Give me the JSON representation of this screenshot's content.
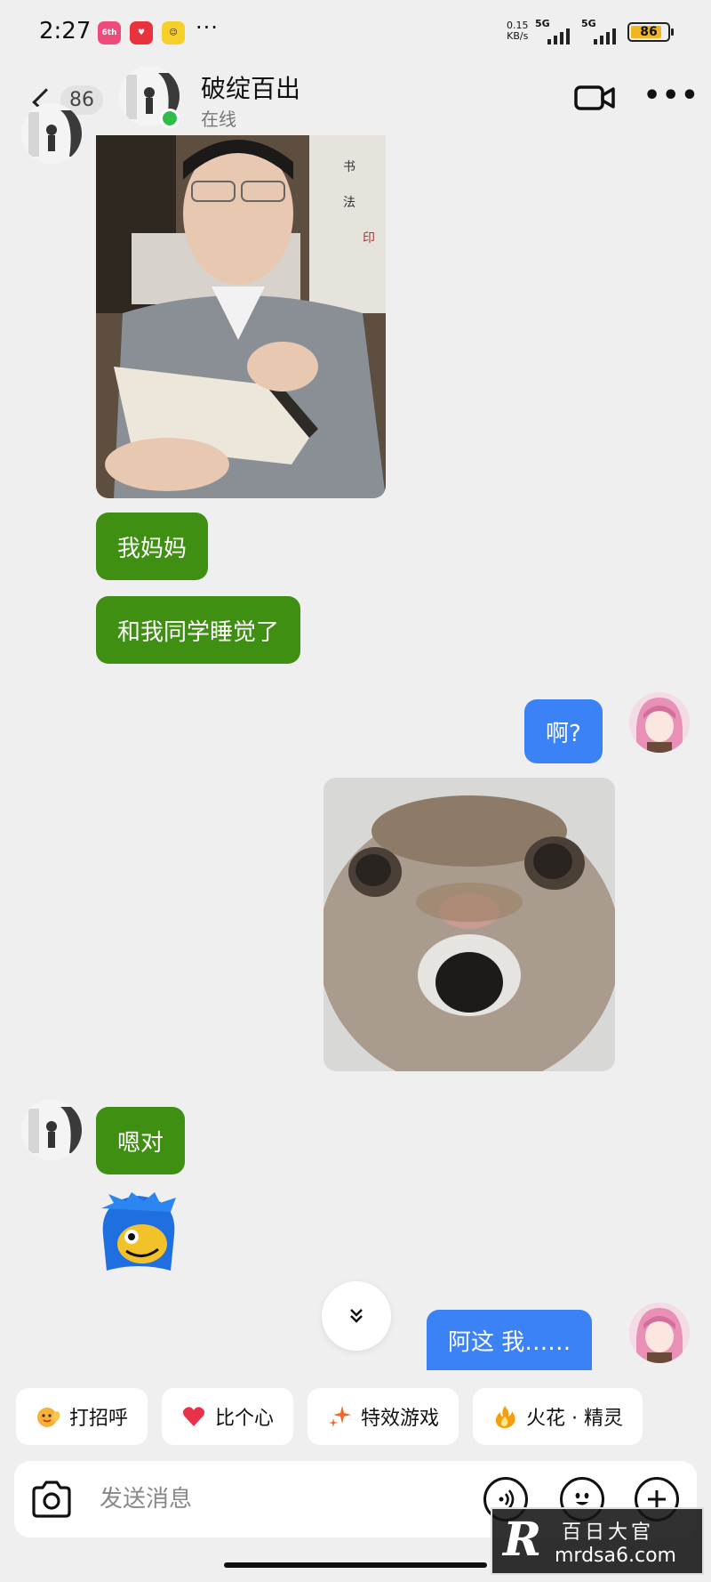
{
  "status_bar": {
    "time": "2:27",
    "apps": [
      {
        "name": "pink-app-icon",
        "text": "6th",
        "color": "#ef4b7a"
      },
      {
        "name": "red-app-icon",
        "text": "",
        "color": "#e8323c"
      },
      {
        "name": "yellow-app-icon",
        "text": "",
        "color": "#f7cf2a"
      }
    ],
    "more": "···",
    "net_speed_value": "0.15",
    "net_speed_unit": "KB/s",
    "signal_label": "5G",
    "battery": "86",
    "battery_level": 0.86
  },
  "header": {
    "unread_count": "86",
    "contact_name": "破绽百出",
    "contact_status": "在线",
    "video_icon": "video-call-icon",
    "more_icon": "more-icon"
  },
  "messages": [
    {
      "id": "m1",
      "side": "them",
      "type": "image",
      "desc": "photo"
    },
    {
      "id": "m2",
      "side": "them",
      "type": "text",
      "text": "我妈妈"
    },
    {
      "id": "m3",
      "side": "them",
      "type": "text",
      "text": "和我同学睡觉了"
    },
    {
      "id": "m4",
      "side": "me",
      "type": "text",
      "text": "啊?"
    },
    {
      "id": "m5",
      "side": "me",
      "type": "image",
      "desc": "photo"
    },
    {
      "id": "m6",
      "side": "them",
      "type": "text",
      "text": "嗯对"
    },
    {
      "id": "m7",
      "side": "them",
      "type": "sticker",
      "desc": "sticker"
    },
    {
      "id": "m8",
      "side": "me",
      "type": "text",
      "text": "阿这 我……"
    }
  ],
  "quick_actions": [
    {
      "label": "打招呼",
      "icon": "wave-emoji-icon"
    },
    {
      "label": "比个心",
      "icon": "heart-icon"
    },
    {
      "label": "特效游戏",
      "icon": "sparkle-icon"
    },
    {
      "label": "火花 · 精灵",
      "icon": "fire-icon"
    }
  ],
  "input": {
    "placeholder": "发送消息",
    "icons": [
      "camera-icon",
      "voice-icon",
      "emoji-icon",
      "plus-icon"
    ]
  },
  "watermark": {
    "line1": "百日大官",
    "line2": "mrdsa6.com",
    "logo": "R"
  },
  "colors": {
    "them_bubble": "#3f8f12",
    "me_bubble": "#3b82f6",
    "background": "#efefef"
  }
}
